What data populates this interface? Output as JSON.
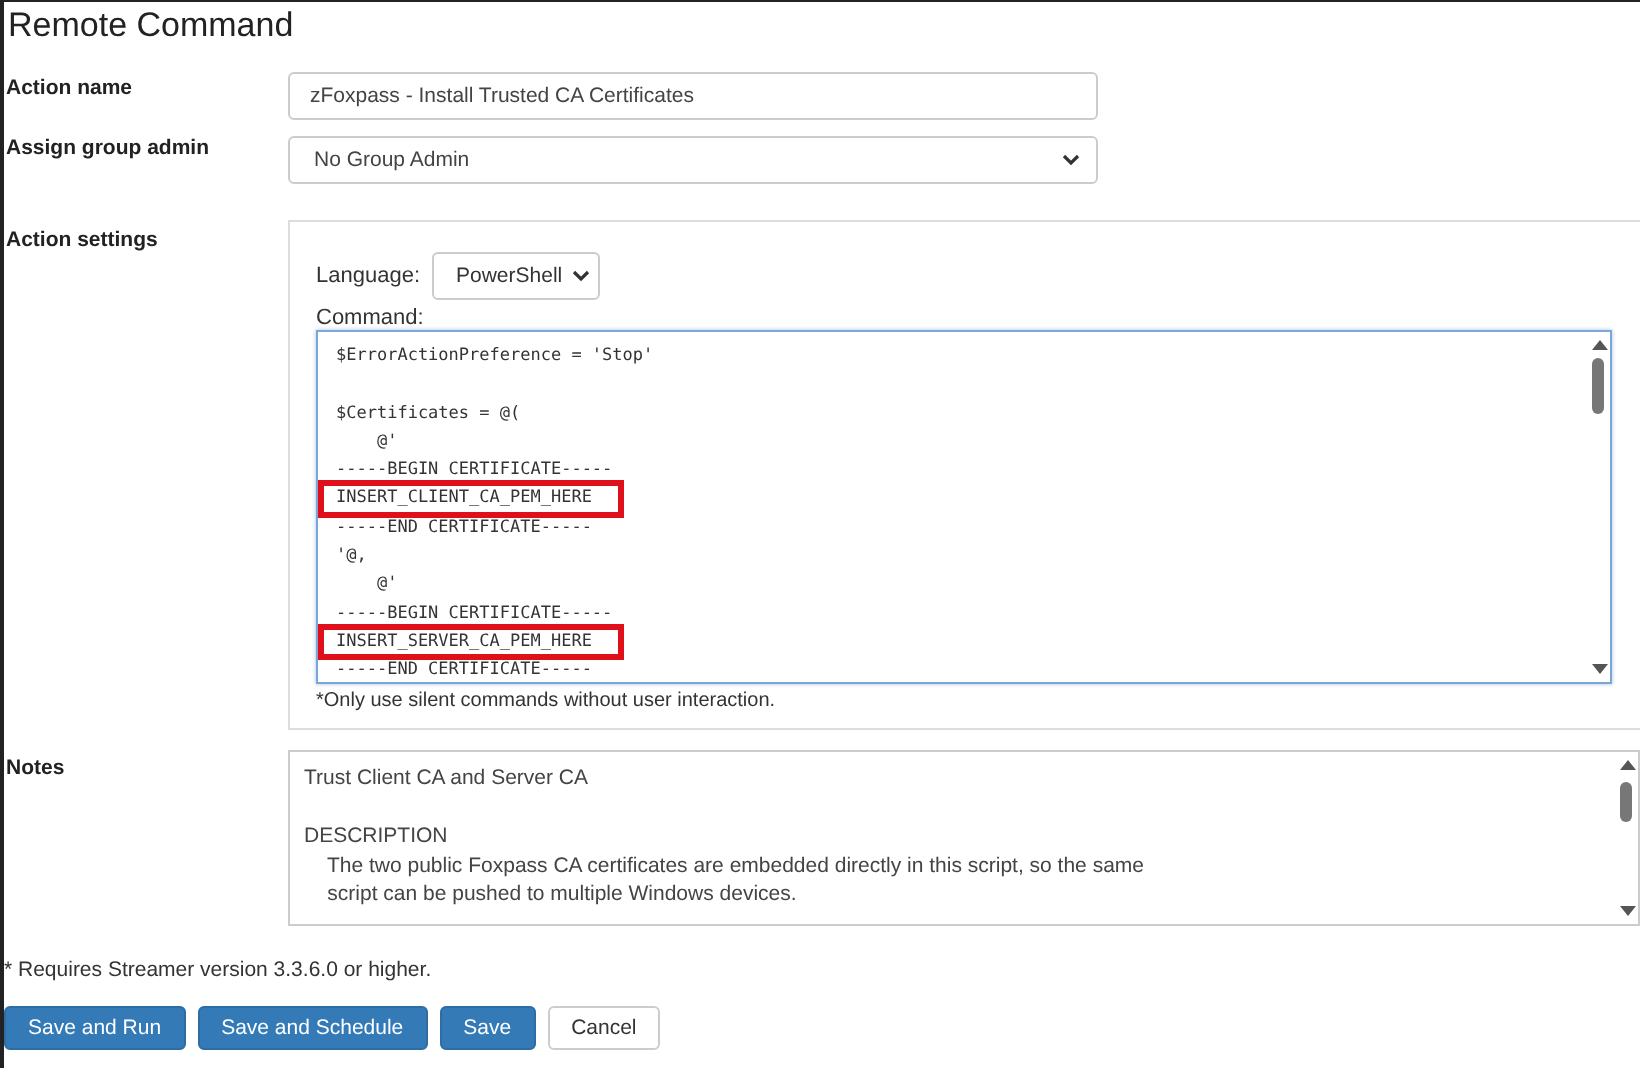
{
  "title": "Remote Command",
  "action_name": {
    "label": "Action name",
    "value": "zFoxpass - Install Trusted CA Certificates"
  },
  "group_admin": {
    "label": "Assign group admin",
    "value": "No Group Admin"
  },
  "action_settings": {
    "label": "Action settings",
    "language_label": "Language:",
    "language": "PowerShell",
    "command_label": "Command:",
    "command_lines": [
      {
        "text": "$ErrorActionPreference = 'Stop'",
        "highlighted": false
      },
      {
        "text": "$Certificates = @(",
        "highlighted": false,
        "gap_before": true
      },
      {
        "text": "    @'",
        "highlighted": false
      },
      {
        "text": "-----BEGIN CERTIFICATE-----",
        "highlighted": false
      },
      {
        "text": "INSERT_CLIENT_CA_PEM_HERE",
        "highlighted": true
      },
      {
        "text": "-----END CERTIFICATE-----",
        "highlighted": false
      },
      {
        "text": "'@,",
        "highlighted": false
      },
      {
        "text": "    @'",
        "highlighted": false
      },
      {
        "text": "-----BEGIN CERTIFICATE-----",
        "highlighted": false
      },
      {
        "text": "INSERT_SERVER_CA_PEM_HERE",
        "highlighted": true
      },
      {
        "text": "-----END CERTIFICATE-----",
        "highlighted": false
      }
    ],
    "hint": "*Only use silent commands without user interaction."
  },
  "notes": {
    "label": "Notes",
    "lines": [
      "Trust Client CA and Server CA",
      {
        "text": "DESCRIPTION",
        "gap_before": true
      },
      "    The two public Foxpass CA certificates are embedded directly in this script, so the same",
      "    script can be pushed to multiple Windows devices."
    ]
  },
  "footnote": "* Requires Streamer version 3.3.6.0 or higher.",
  "buttons": [
    {
      "label": "Save and Run",
      "kind": "primary"
    },
    {
      "label": "Save and Schedule",
      "kind": "primary"
    },
    {
      "label": "Save",
      "kind": "primary"
    },
    {
      "label": "Cancel",
      "kind": "default"
    }
  ]
}
